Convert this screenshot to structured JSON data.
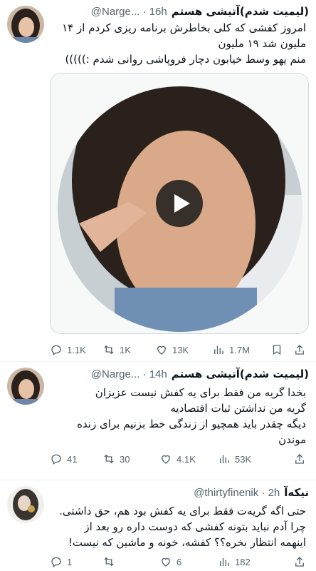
{
  "tweets": [
    {
      "display_name": "(لیمیت شدم)آتیشی هستم",
      "handle": "@Narge...",
      "time": "16h",
      "lines": [
        "امروز کفشی که کلی بخاطرش برنامه ریزی کردم از ۱۴",
        "ملیون شد ۱۹ ملیون",
        "منم یهو وسط خیابون دچار فروپاشی روانی شدم :)))))"
      ],
      "stats": {
        "replies": "1.1K",
        "reposts": "1K",
        "likes": "13K",
        "views": "1.7M"
      }
    },
    {
      "display_name": "(لیمیت شدم)آتیشی هستم",
      "handle": "@Narge...",
      "time": "14h",
      "lines": [
        "بخدا گریه من فقط برای یه کفش نیست عزیزان",
        "گریه من نداشتن ثبات اقتصادیه",
        "دیگه چقدر باید همچیو از زندگی خط بزنیم برای زنده",
        "موندن"
      ],
      "stats": {
        "replies": "41",
        "reposts": "30",
        "likes": "4.1K",
        "views": "53K"
      }
    },
    {
      "display_name": "نیکه‌آ",
      "handle": "@thirtyfinenik",
      "time": "2h",
      "lines": [
        "حتی اگه گریه‌ت فقط برای یه کفش بود هم، حق داشتی.",
        "چرا آدم نباید بتونه کفشی که دوست داره رو بعد از",
        "اینهمه انتظار بخره؟؟ کفشه، خونه و ماشین که نیست!"
      ],
      "stats": {
        "replies": "1",
        "reposts": "",
        "likes": "6",
        "views": "182"
      }
    }
  ],
  "icons": {
    "reply": "reply-icon",
    "repost": "repost-icon",
    "like": "heart-icon",
    "views": "views-icon",
    "bookmark": "bookmark-icon",
    "share": "share-icon",
    "play": "play-icon"
  },
  "colors": {
    "meta": "#536471",
    "text": "#0f1419",
    "divider": "#eff3f4"
  }
}
